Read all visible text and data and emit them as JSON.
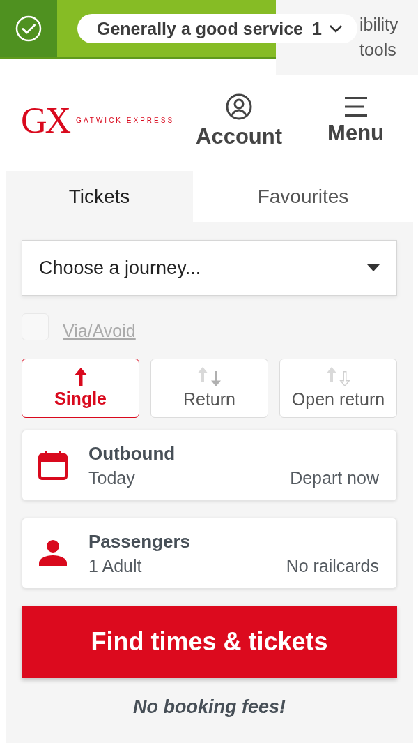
{
  "status_banner": {
    "message": "Generally a good service",
    "count": "1"
  },
  "accessibility": {
    "label": "ibility tools"
  },
  "header": {
    "logo": {
      "mark": "GX",
      "wordmark": "GATWICK EXPRESS"
    },
    "account": "Account",
    "menu": "Menu"
  },
  "tabs": [
    {
      "label": "Tickets",
      "selected": true
    },
    {
      "label": "Favourites",
      "selected": false
    }
  ],
  "journey_select": {
    "placeholder": "Choose a journey..."
  },
  "via_avoid": {
    "label": "Via/Avoid",
    "checked": false,
    "disabled": true
  },
  "ticket_types": [
    {
      "label": "Single",
      "kind": "single",
      "selected": true
    },
    {
      "label": "Return",
      "kind": "return",
      "selected": false
    },
    {
      "label": "Open return",
      "kind": "open_return",
      "selected": false
    }
  ],
  "outbound": {
    "title": "Outbound",
    "date": "Today",
    "time": "Depart now"
  },
  "passengers": {
    "title": "Passengers",
    "count": "1 Adult",
    "railcards": "No railcards"
  },
  "search_button": "Find times & tickets",
  "note": "No booking fees!"
}
